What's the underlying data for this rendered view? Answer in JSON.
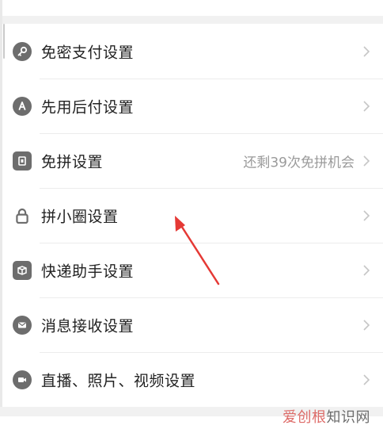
{
  "settings": {
    "items": [
      {
        "label": "免密支付设置",
        "icon": "key-icon",
        "extra": ""
      },
      {
        "label": "先用后付设置",
        "icon": "badge-icon",
        "extra": ""
      },
      {
        "label": "免拼设置",
        "icon": "ticket-icon",
        "extra": "还剩39次免拼机会"
      },
      {
        "label": "拼小圈设置",
        "icon": "lock-icon",
        "extra": ""
      },
      {
        "label": "快递助手设置",
        "icon": "package-icon",
        "extra": ""
      },
      {
        "label": "消息接收设置",
        "icon": "mail-icon",
        "extra": ""
      },
      {
        "label": "直播、照片、视频设置",
        "icon": "video-camera-icon",
        "extra": ""
      }
    ]
  },
  "watermark": {
    "part1": "爱创根",
    "part2": "知识网"
  },
  "colors": {
    "icon_bg": "#6d6d6d",
    "arrow": "#e53935",
    "text": "#222222",
    "muted": "#9a9a9a"
  }
}
